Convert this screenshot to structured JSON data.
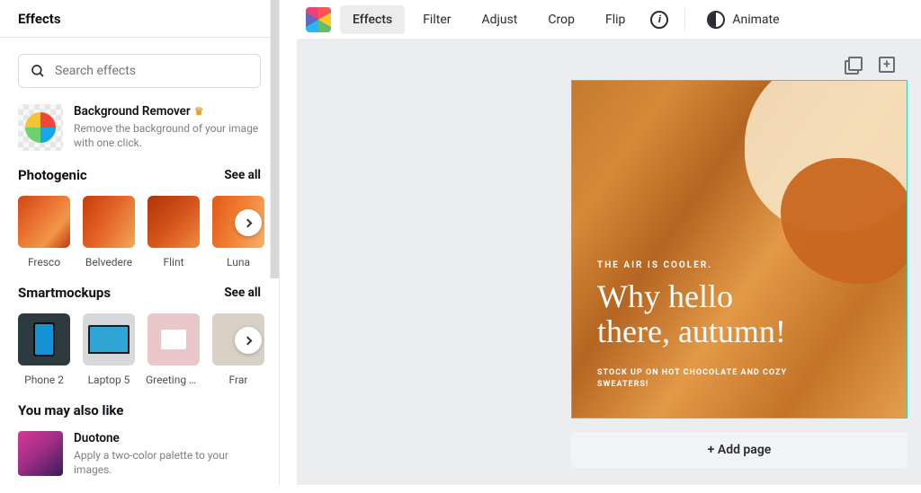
{
  "sidebar": {
    "title": "Effects",
    "search_placeholder": "Search effects",
    "bg_remover": {
      "title": "Background Remover",
      "desc": "Remove the background of your image with one click."
    },
    "section_photogenic": {
      "name": "Photogenic",
      "see_all": "See all"
    },
    "photogenic_items": [
      {
        "label": "Fresco"
      },
      {
        "label": "Belvedere"
      },
      {
        "label": "Flint"
      },
      {
        "label": "Luna"
      }
    ],
    "section_smartmockups": {
      "name": "Smartmockups",
      "see_all": "See all"
    },
    "smartmockups_items": [
      {
        "label": "Phone 2"
      },
      {
        "label": "Laptop 5"
      },
      {
        "label": "Greeting car..."
      },
      {
        "label": "Frar"
      }
    ],
    "also_title": "You may also like",
    "duotone": {
      "title": "Duotone",
      "desc": "Apply a two-color palette to your images."
    }
  },
  "toolbar": {
    "effects": "Effects",
    "filter": "Filter",
    "adjust": "Adjust",
    "crop": "Crop",
    "flip": "Flip",
    "animate": "Animate"
  },
  "canvas": {
    "pre": "THE AIR IS COOLER.",
    "headline": "Why hello there, autumn!",
    "sub": "Stock up on hot chocolate and cozy sweaters!",
    "add_page": "+ Add page"
  }
}
